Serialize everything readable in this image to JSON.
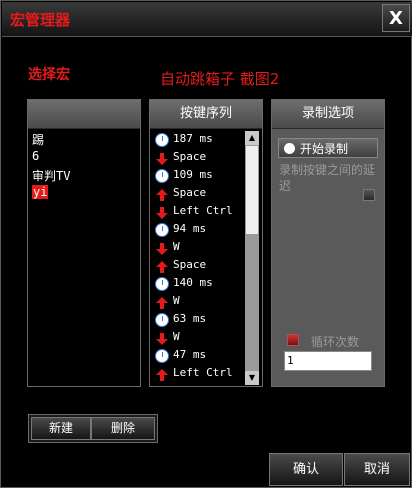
{
  "window": {
    "title": "宏管理器",
    "close_label": "X"
  },
  "select_macro_label": "选择宏",
  "macro_title": "自动跳箱子 截图2",
  "macro_list": {
    "items": [
      "踢",
      "6",
      "审判TV",
      "yi"
    ],
    "selected": "yi"
  },
  "key_sequence": {
    "header": "按键序列",
    "rows": [
      {
        "icon": "clock-icon",
        "text": "187 ms"
      },
      {
        "icon": "key-down-icon",
        "text": "Space"
      },
      {
        "icon": "clock-icon",
        "text": "109 ms"
      },
      {
        "icon": "key-up-icon",
        "text": "Space"
      },
      {
        "icon": "key-down-icon",
        "text": "Left Ctrl"
      },
      {
        "icon": "clock-icon",
        "text": "94 ms"
      },
      {
        "icon": "key-down-icon",
        "text": "W"
      },
      {
        "icon": "key-up-icon",
        "text": "Space"
      },
      {
        "icon": "clock-icon",
        "text": "140 ms"
      },
      {
        "icon": "key-up-icon",
        "text": "W"
      },
      {
        "icon": "clock-icon",
        "text": "63 ms"
      },
      {
        "icon": "key-down-icon",
        "text": "W"
      },
      {
        "icon": "clock-icon",
        "text": "47 ms"
      },
      {
        "icon": "key-up-icon",
        "text": "Left Ctrl"
      }
    ]
  },
  "record_options": {
    "header": "录制选项",
    "start_record_label": "开始录制",
    "record_delay_label": "录制按键之间的延迟",
    "loop_count_label": "循环次数",
    "loop_count_value": "1"
  },
  "buttons": {
    "new_label": "新建",
    "delete_label": "删除",
    "confirm_label": "确认",
    "cancel_label": "取消"
  },
  "colors": {
    "accent": "#e41b1b",
    "background": "#000000",
    "clock": "#3a7bd5"
  }
}
